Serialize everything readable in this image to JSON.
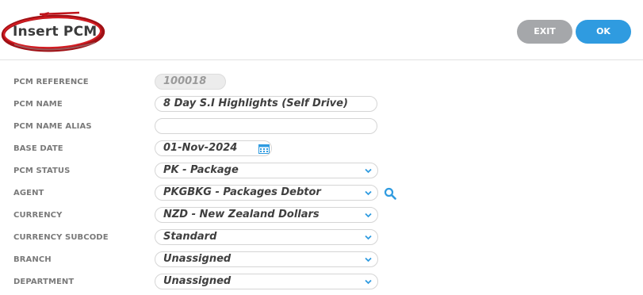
{
  "header": {
    "title": "Insert PCM",
    "exit_label": "EXIT",
    "ok_label": "OK"
  },
  "form": {
    "reference": {
      "label": "PCM REFERENCE",
      "value": "100018"
    },
    "name": {
      "label": "PCM NAME",
      "value": "8 Day S.I Highlights (Self Drive)"
    },
    "alias": {
      "label": "PCM NAME ALIAS",
      "value": ""
    },
    "base_date": {
      "label": "BASE DATE",
      "value": "01-Nov-2024"
    },
    "status": {
      "label": "PCM STATUS",
      "value": "PK - Package"
    },
    "agent": {
      "label": "AGENT",
      "value": "PKGBKG - Packages Debtor"
    },
    "currency": {
      "label": "CURRENCY",
      "value": "NZD - New Zealand Dollars"
    },
    "currency_subcode": {
      "label": "CURRENCY SUBCODE",
      "value": "Standard"
    },
    "branch": {
      "label": "BRANCH",
      "value": "Unassigned"
    },
    "department": {
      "label": "DEPARTMENT",
      "value": "Unassigned"
    }
  },
  "icons": {
    "calendar": "calendar-icon",
    "search": "search-icon",
    "chevron": "chevron-down-icon",
    "annotation": "red-circle-annotation"
  },
  "colors": {
    "ok_button": "#2f9be0",
    "exit_button": "#a5a7aa",
    "accent_icon": "#2f9be0",
    "annotation": "#c0141b"
  }
}
